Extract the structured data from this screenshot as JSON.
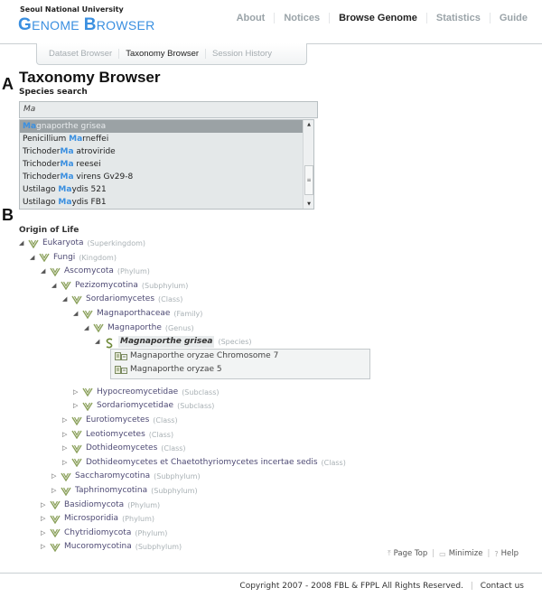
{
  "header": {
    "university": "Seoul National University",
    "brand_first_initial": "G",
    "brand_first_rest": "ENOME",
    "brand_second_initial": "B",
    "brand_second_rest": "ROWSER",
    "nav": [
      {
        "label": "About",
        "active": false
      },
      {
        "label": "Notices",
        "active": false
      },
      {
        "label": "Browse Genome",
        "active": true
      },
      {
        "label": "Statistics",
        "active": false
      },
      {
        "label": "Guide",
        "active": false
      }
    ]
  },
  "subnav": [
    {
      "label": "Dataset Browser",
      "active": false
    },
    {
      "label": "Taxonomy Browser",
      "active": true
    },
    {
      "label": "Session History",
      "active": false
    }
  ],
  "panel_labels": {
    "a": "A",
    "b": "B"
  },
  "page_title": "Taxonomy Browser",
  "search": {
    "label": "Species search",
    "value": "Ma",
    "suggestions": [
      {
        "pre": "",
        "match": "Ma",
        "post": "gnaporthe grisea",
        "selected": true
      },
      {
        "pre": "Penicillium ",
        "match": "Ma",
        "post": "rneffei",
        "selected": false
      },
      {
        "pre": "Trichoder",
        "match": "Ma",
        "post": " atroviride",
        "selected": false
      },
      {
        "pre": "Trichoder",
        "match": "Ma",
        "post": " reesei",
        "selected": false
      },
      {
        "pre": "Trichoder",
        "match": "Ma",
        "post": " virens Gv29-8",
        "selected": false
      },
      {
        "pre": "Ustilago ",
        "match": "Ma",
        "post": "ydis 521",
        "selected": false
      },
      {
        "pre": "Ustilago ",
        "match": "Ma",
        "post": "ydis FB1",
        "selected": false
      }
    ]
  },
  "tree": {
    "root_label": "Origin of Life",
    "nodes": [
      {
        "name": "Eukaryota",
        "rank": "(Superkingdom)",
        "depth": 0,
        "expanded": true
      },
      {
        "name": "Fungi",
        "rank": "(Kingdom)",
        "depth": 1,
        "expanded": true
      },
      {
        "name": "Ascomycota",
        "rank": "(Phylum)",
        "depth": 2,
        "expanded": true
      },
      {
        "name": "Pezizomycotina",
        "rank": "(Subphylum)",
        "depth": 3,
        "expanded": true
      },
      {
        "name": "Sordariomycetes",
        "rank": "(Class)",
        "depth": 4,
        "expanded": true
      },
      {
        "name": "Magnaporthaceae",
        "rank": "(Family)",
        "depth": 5,
        "expanded": true
      },
      {
        "name": "Magnaporthe",
        "rank": "(Genus)",
        "depth": 6,
        "expanded": true
      },
      {
        "name": "Magnaporthe grisea",
        "rank": "(Species)",
        "depth": 7,
        "expanded": true,
        "species": true
      },
      {
        "name": "Hypocreomycetidae",
        "rank": "(Subclass)",
        "depth": 5,
        "expanded": false
      },
      {
        "name": "Sordariomycetidae",
        "rank": "(Subclass)",
        "depth": 5,
        "expanded": false
      },
      {
        "name": "Eurotiomycetes",
        "rank": "(Class)",
        "depth": 4,
        "expanded": false
      },
      {
        "name": "Leotiomycetes",
        "rank": "(Class)",
        "depth": 4,
        "expanded": false
      },
      {
        "name": "Dothideomycetes",
        "rank": "(Class)",
        "depth": 4,
        "expanded": false
      },
      {
        "name": "Dothideomycetes et Chaetothyriomycetes incertae sedis",
        "rank": "(Class)",
        "depth": 4,
        "expanded": false
      },
      {
        "name": "Saccharomycotina",
        "rank": "(Subphylum)",
        "depth": 3,
        "expanded": false
      },
      {
        "name": "Taphrinomycotina",
        "rank": "(Subphylum)",
        "depth": 3,
        "expanded": false
      },
      {
        "name": "Basidiomycota",
        "rank": "(Phylum)",
        "depth": 2,
        "expanded": false
      },
      {
        "name": "Microsporidia",
        "rank": "(Phylum)",
        "depth": 2,
        "expanded": false
      },
      {
        "name": "Chytridiomycota",
        "rank": "(Phylum)",
        "depth": 2,
        "expanded": false
      },
      {
        "name": "Mucoromycotina",
        "rank": "(Subphylum)",
        "depth": 2,
        "expanded": false
      }
    ],
    "datasets": [
      {
        "label": "Magnaporthe oryzae Chromosome 7"
      },
      {
        "label": "Magnaporthe oryzae 5"
      }
    ]
  },
  "bottom_links": {
    "page_top": "Page Top",
    "minimize": "Minimize",
    "help": "Help"
  },
  "footer": {
    "copyright": "Copyright 2007 - 2008 FBL & FPPL All Rights Reserved.",
    "contact": "Contact us"
  },
  "colors": {
    "brand": "#3a8fe0",
    "match": "#3a8fe0",
    "node_name": "#4e4a74",
    "rank": "#a9b1b5"
  }
}
